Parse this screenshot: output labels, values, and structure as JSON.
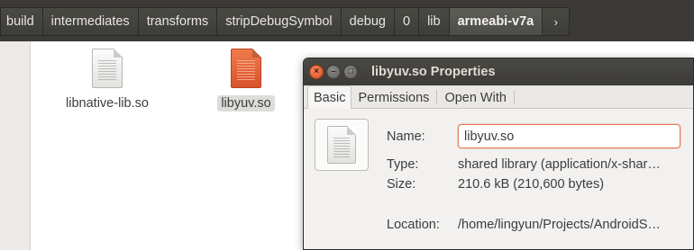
{
  "pathbar": {
    "crumbs": [
      "build",
      "intermediates",
      "transforms",
      "stripDebugSymbol",
      "debug",
      "0",
      "lib",
      "armeabi-v7a"
    ],
    "more_glyph": "›"
  },
  "files": [
    {
      "name": "libnative-lib.so",
      "icon": "shared-library-icon",
      "selected": false
    },
    {
      "name": "libyuv.so",
      "icon": "shared-library-icon",
      "selected": true
    }
  ],
  "dialog": {
    "title": "libyuv.so Properties",
    "close_glyph": "×",
    "min_glyph": "–",
    "max_glyph": "□",
    "tabs": [
      "Basic",
      "Permissions",
      "Open With"
    ],
    "active_tab": "Basic",
    "name_label": "Name:",
    "name_value": "libyuv.so",
    "type_label": "Type:",
    "type_value": "shared library (application/x-shar…",
    "size_label": "Size:",
    "size_value": "210.6 kB (210,600 bytes)",
    "location_label": "Location:",
    "location_value": "/home/lingyun/Projects/AndroidS…"
  },
  "colors": {
    "accent_orange": "#df4b1c",
    "pathbar_bg": "#3b3a36",
    "selection_bg": "#dddcd8"
  }
}
